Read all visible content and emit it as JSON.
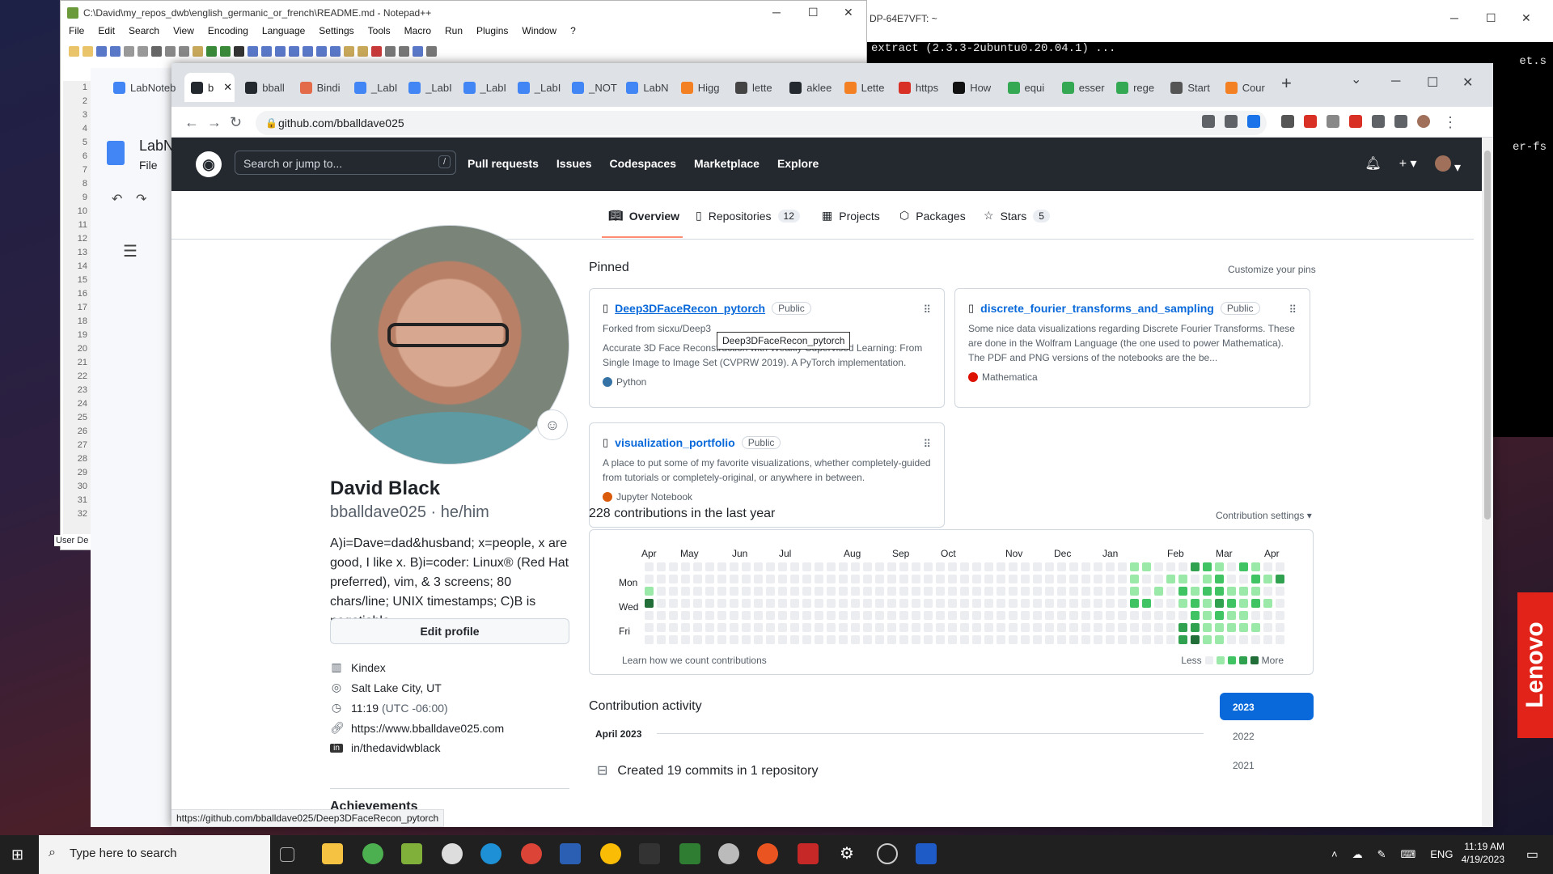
{
  "notepad": {
    "title": "C:\\David\\my_repos_dwb\\english_germanic_or_french\\README.md - Notepad++",
    "menu": [
      "File",
      "Edit",
      "Search",
      "View",
      "Encoding",
      "Language",
      "Settings",
      "Tools",
      "Macro",
      "Run",
      "Plugins",
      "Window",
      "?"
    ],
    "line_numbers": [
      "1",
      "2",
      "3",
      "4",
      "5",
      "6",
      "7",
      "8",
      "9",
      "10",
      "11",
      "12",
      "13",
      "14",
      "15",
      "16",
      "17",
      "18",
      "19",
      "20",
      "21",
      "22",
      "23",
      "24",
      "25",
      "26",
      "27",
      "28",
      "29",
      "30",
      "31",
      "32"
    ],
    "user_defined": "User De"
  },
  "terminal": {
    "title": "DP-64E7VFT: ~",
    "line1": "extract (2.3.3-2ubuntu0.20.04.1) ...",
    "line2": "et.s",
    "line3": "er-fs"
  },
  "docs": {
    "title": "LabN",
    "file_menu": "File"
  },
  "browser": {
    "tabs": [
      {
        "label": "b",
        "color": "#24292f",
        "active": true
      },
      {
        "label": "bball",
        "color": "#24292f"
      },
      {
        "label": "Bindi",
        "color": "#e46b4a"
      },
      {
        "label": "_LabI",
        "color": "#4285f4"
      },
      {
        "label": "_LabI",
        "color": "#4285f4"
      },
      {
        "label": "_LabI",
        "color": "#4285f4"
      },
      {
        "label": "_LabI",
        "color": "#4285f4"
      },
      {
        "label": "_NOT",
        "color": "#4285f4"
      },
      {
        "label": "LabN",
        "color": "#4285f4"
      },
      {
        "label": "Higg",
        "color": "#f48024"
      },
      {
        "label": "lette",
        "color": "#444"
      },
      {
        "label": "aklee",
        "color": "#24292f"
      },
      {
        "label": "Lette",
        "color": "#f48024"
      },
      {
        "label": "https",
        "color": "#d93025"
      },
      {
        "label": "How",
        "color": "#111"
      },
      {
        "label": "equi",
        "color": "#34a853"
      },
      {
        "label": "esser",
        "color": "#34a853"
      },
      {
        "label": "rege",
        "color": "#34a853"
      },
      {
        "label": "Start",
        "color": "#555"
      },
      {
        "label": "Cour",
        "color": "#f48024"
      }
    ],
    "first_tab_label": "LabNoteb",
    "url": "github.com/bballdave025",
    "status_url": "https://github.com/bballdave025/Deep3DFaceRecon_pytorch"
  },
  "github": {
    "search_placeholder": "Search or jump to...",
    "search_key": "/",
    "nav": [
      "Pull requests",
      "Issues",
      "Codespaces",
      "Marketplace",
      "Explore"
    ],
    "tabs": {
      "overview": "Overview",
      "repositories": "Repositories",
      "repositories_count": "12",
      "projects": "Projects",
      "packages": "Packages",
      "stars": "Stars",
      "stars_count": "5"
    },
    "profile": {
      "name": "David Black",
      "login": "bballdave025 · he/him",
      "bio": "A)i=Dave=dad&husband; x=people, x are good, I like x. B)i=coder: Linux® (Red Hat preferred), vim, & 3 screens; 80 chars/line; UNIX timestamps; C)B is negotiable",
      "edit_label": "Edit profile",
      "company": "Kindex",
      "location": "Salt Lake City, UT",
      "time": "11:19",
      "tz": "(UTC -06:00)",
      "website": "https://www.bballdave025.com",
      "linkedin": "in/thedavidwblack",
      "achievements": "Achievements"
    },
    "pinned_title": "Pinned",
    "customize": "Customize your pins",
    "pins": [
      {
        "name": "Deep3DFaceRecon_pytorch",
        "visibility": "Public",
        "fork": "Forked from sicxu/Deep3",
        "desc": "Accurate 3D Face Reconstruction with Weakly-Supervised Learning: From Single Image to Image Set (CVPRW 2019). A PyTorch implementation.",
        "lang": "Python",
        "lang_color": "#3572a5"
      },
      {
        "name": "discrete_fourier_transforms_and_sampling",
        "visibility": "Public",
        "desc": "Some nice data visualizations regarding Discrete Fourier Transforms. These are done in the Wolfram Language (the one used to power Mathematica). The PDF and PNG versions of the notebooks are the be...",
        "lang": "Mathematica",
        "lang_color": "#dd1100"
      },
      {
        "name": "visualization_portfolio",
        "visibility": "Public",
        "desc": "A place to put some of my favorite visualizations, whether completely-guided from tutorials or completely-original, or anywhere in between.",
        "lang": "Jupyter Notebook",
        "lang_color": "#da5b0b"
      }
    ],
    "tooltip": "Deep3DFaceRecon_pytorch",
    "contrib_title": "228 contributions in the last year",
    "contrib_settings": "Contribution settings ▾",
    "months": [
      "Apr",
      "May",
      "Jun",
      "Jul",
      "Aug",
      "Sep",
      "Oct",
      "Nov",
      "Dec",
      "Jan",
      "Feb",
      "Mar",
      "Apr"
    ],
    "days": [
      "Mon",
      "Wed",
      "Fri"
    ],
    "learn": "Learn how we count contributions",
    "less": "Less",
    "more": "More",
    "activity_title": "Contribution activity",
    "years": [
      "2023",
      "2022",
      "2021"
    ],
    "month_heading": "April 2023",
    "commit_summary": "Created 19 commits in 1 repository",
    "levels": [
      "#ebedf0",
      "#9be9a8",
      "#40c463",
      "#30a14e",
      "#216e39"
    ]
  },
  "taskbar": {
    "search_placeholder": "Type here to search",
    "lang": "ENG",
    "time": "11:19 AM",
    "date": "4/19/2023"
  },
  "brand": "Lenovo"
}
